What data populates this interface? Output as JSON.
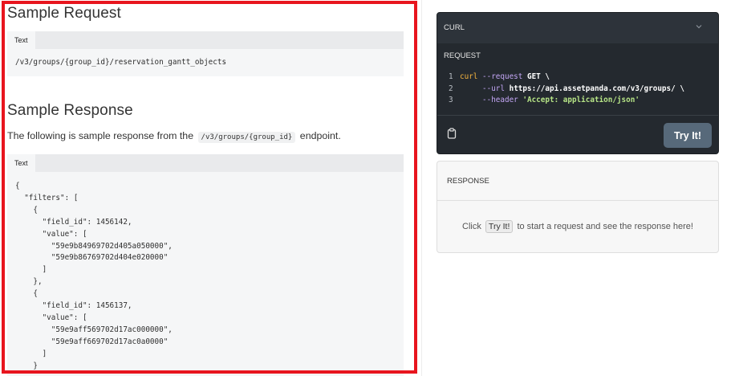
{
  "sample_request": {
    "title": "Sample Request",
    "tab_label": "Text",
    "code": "/v3/groups/{group_id}/reservation_gantt_objects"
  },
  "sample_response": {
    "title": "Sample Response",
    "desc_before": "The following is sample response from the",
    "desc_code": "/v3/groups/{group_id}",
    "desc_after": "endpoint.",
    "tab_label": "Text",
    "code": "{\n  \"filters\": [\n    {\n      \"field_id\": 1456142,\n      \"value\": [\n        \"59e9b84969702d405a050000\",\n        \"59e9b86769702d404e020000\"\n      ]\n    },\n    {\n      \"field_id\": 1456137,\n      \"value\": [\n        \"59e9aff569702d17ac000000\",\n        \"59e9aff669702d17ac0a0000\"\n      ]\n    }"
  },
  "curl_panel": {
    "title": "CURL",
    "chevron_icon": "chevron-down-icon",
    "request_label": "REQUEST",
    "lines": [
      {
        "num": "1",
        "cmd": "curl",
        "flag": "--request",
        "arg": "GET",
        "tail": "\\"
      },
      {
        "num": "2",
        "flag": "--url",
        "arg": "https://api.assetpanda.com/v3/groups/",
        "tail": "\\"
      },
      {
        "num": "3",
        "flag": "--header",
        "str": "'Accept: application/json'"
      }
    ],
    "clipboard_icon": "clipboard-icon",
    "try_button": "Try It!"
  },
  "response_panel": {
    "title": "RESPONSE",
    "msg_before": "Click",
    "msg_button": "Try It!",
    "msg_after": "to start a request and see the response here!"
  },
  "colors": {
    "highlight_border": "#e8151e",
    "curl_bg": "#24292f",
    "try_button_bg": "#57697a",
    "code_bg": "#f5f6f7"
  }
}
